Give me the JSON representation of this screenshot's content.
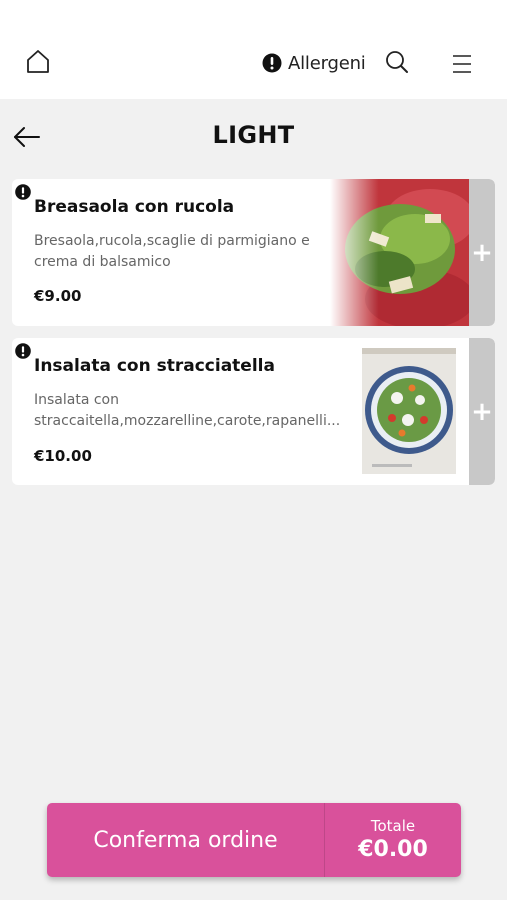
{
  "header": {
    "allergens_label": "Allergeni"
  },
  "category": {
    "title": "LIGHT"
  },
  "products": [
    {
      "name": "Breasaola con rucola",
      "description": "Bresaola,rucola,scaglie di parmigiano e crema di balsamico",
      "price": "€9.00",
      "add_label": "+"
    },
    {
      "name": "Insalata con stracciatella",
      "description": "Insalata con straccaitella,mozzarelline,carote,rapanelli...",
      "price": "€10.00",
      "add_label": "+"
    }
  ],
  "order": {
    "confirm_label": "Conferma ordine",
    "total_label": "Totale",
    "total_value": "€0.00"
  },
  "colors": {
    "accent": "#d9519b",
    "add_button": "#c8c8c8",
    "background": "#f1f1f1"
  }
}
